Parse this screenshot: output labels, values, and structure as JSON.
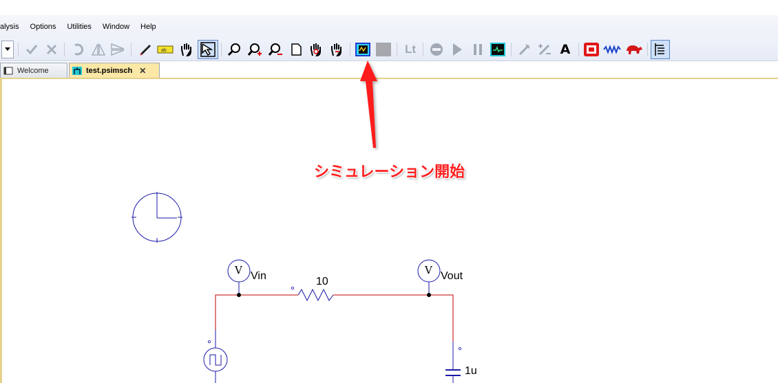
{
  "menu": {
    "items": [
      "alysis",
      "Options",
      "Utilities",
      "Window",
      "Help"
    ]
  },
  "toolbar": {
    "icons": [
      "dropdown-arrow-icon",
      "check-icon",
      "cross-icon",
      "rotate-icon",
      "flip-horizontal-icon",
      "flip-vertical-icon",
      "pen-icon",
      "label-icon",
      "pan-hand-icon",
      "select-arrow-icon",
      "zoom-icon",
      "zoom-in-icon",
      "zoom-out-icon",
      "page-icon",
      "zoom-hand-icon",
      "zoom-fit-hand-icon",
      "run-simulation-icon",
      "stop-simulation-icon",
      "lt-icon",
      "stop-icon",
      "play-icon",
      "pause-icon",
      "scope-icon",
      "probe-icon",
      "plus-minus-icon",
      "text-icon",
      "element-icon",
      "waveform-icon",
      "animal-icon",
      "properties-icon"
    ],
    "lt_label": "Lt",
    "text_label": "A"
  },
  "tabs": [
    {
      "label": "Welcome",
      "active": false
    },
    {
      "label": "test.psimsch",
      "active": true,
      "close": "✕"
    }
  ],
  "annotation": {
    "text": "シミュレーション開始",
    "color": "#ff1f1f"
  },
  "schematic": {
    "resistor_value": "10",
    "capacitor_value": "1u",
    "voltmeter_symbol": "V",
    "probe_in": "Vin",
    "probe_out": "Vout",
    "wire_color": "#c00000",
    "component_color": "#1a1aa8"
  }
}
